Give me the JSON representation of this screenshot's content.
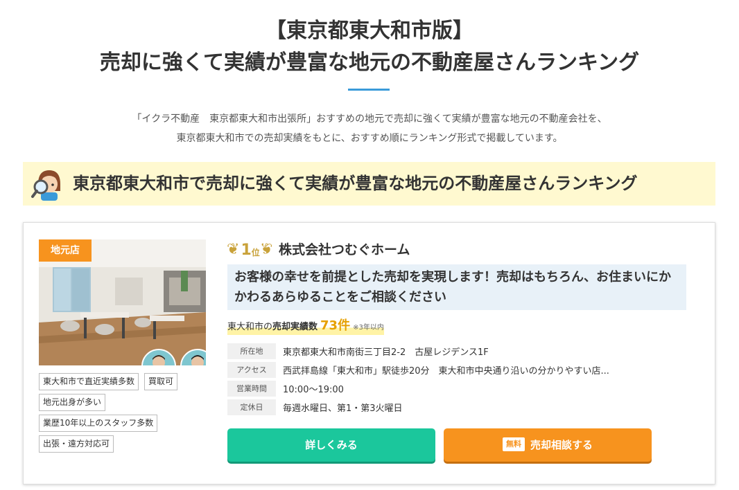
{
  "header": {
    "title_line1": "【東京都東大和市版】",
    "title_line2": "売却に強くて実績が豊富な地元の不動産屋さんランキング"
  },
  "intro": {
    "line1": "「イクラ不動産　東京都東大和市出張所」おすすめの地元で売却に強くて実績が豊富な地元の不動産会社を、",
    "line2": "東京都東大和市での売却実績をもとに、おすすめ順にランキング形式で掲載しています。"
  },
  "section": {
    "heading": "東京都東大和市で売却に強くて実績が豊富な地元の不動産屋さんランキング",
    "avatar_icon": "magnifier-girl-icon"
  },
  "card": {
    "badge": "地元店",
    "tags": [
      "東大和市で直近実績多数",
      "買取可",
      "地元出身が多い",
      "業歴10年以上のスタッフ多数",
      "出張・遠方対応可"
    ],
    "rank": {
      "number": "1",
      "unit": "位"
    },
    "company": "株式会社つむぐホーム",
    "catch": "お客様の幸せを前提とした売却を実現します！売却はもちろん、お住まいにかかわるあらゆることをご相談ください",
    "record": {
      "prefix": "東大和市の",
      "label": "売却実績数",
      "count": "73件",
      "note": "※3年以内"
    },
    "info": [
      {
        "label": "所在地",
        "value": "東京都東大和市南街三丁目2-2　古屋レジデンス1F"
      },
      {
        "label": "アクセス",
        "value": "西武拝島線「東大和市」駅徒歩20分　東大和市中央通り沿いの分かりやすい店..."
      },
      {
        "label": "営業時間",
        "value": "10:00〜19:00"
      },
      {
        "label": "定休日",
        "value": "毎週水曜日、第1・第3火曜日"
      }
    ],
    "buttons": {
      "detail": "詳しくみる",
      "consult_badge": "無料",
      "consult": "売却相談する"
    }
  },
  "colors": {
    "accent_blue": "#3a9ad9",
    "highlight_yellow": "#fff9d0",
    "detail_green": "#1bc79c",
    "consult_orange": "#f7931e",
    "rank_gold": "#c9a23a"
  }
}
